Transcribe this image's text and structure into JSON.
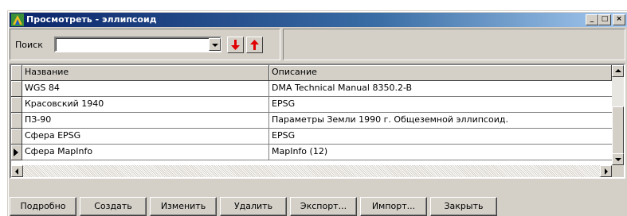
{
  "window": {
    "title": "Просмотреть - эллипсоид",
    "minimize_label": "_",
    "maximize_label": "□",
    "close_label": "×"
  },
  "search": {
    "label": "Поиск",
    "value": "",
    "down_arrow_color": "#e00000",
    "up_arrow_color": "#e00000"
  },
  "grid": {
    "columns": [
      "Название",
      "Описание"
    ],
    "rows": [
      {
        "name": "WGS 84",
        "description": "DMA Technical Manual 8350.2-B"
      },
      {
        "name": "Красовский 1940",
        "description": "EPSG"
      },
      {
        "name": "ПЗ-90",
        "description": "Параметры Земли 1990 г. Общеземной эллипсоид."
      },
      {
        "name": "Сфера EPSG",
        "description": "EPSG"
      },
      {
        "name": "Сфера MapInfo",
        "description": "MapInfo (12)"
      }
    ],
    "current_row": 5
  },
  "buttons": {
    "details": "Подробно",
    "create": "Создать",
    "edit": "Изменить",
    "delete": "Удалить",
    "export": "Экспорт...",
    "import": "Импорт...",
    "close": "Закрыть"
  }
}
